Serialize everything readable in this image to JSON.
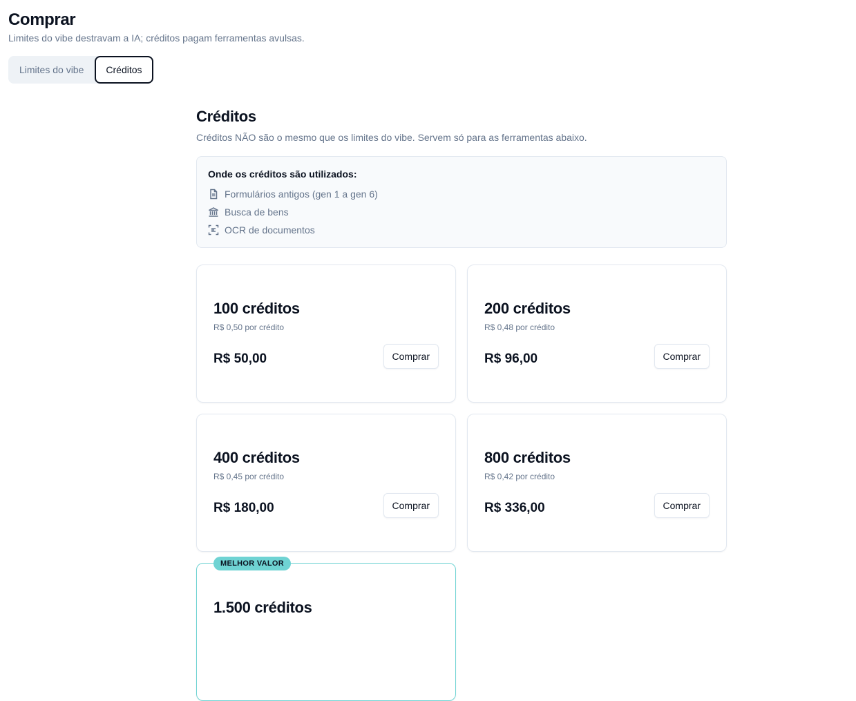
{
  "header": {
    "title": "Comprar",
    "subtitle": "Limites do vibe destravam a IA; créditos pagam ferramentas avulsas."
  },
  "tabs": [
    {
      "label": "Limites do vibe",
      "active": false
    },
    {
      "label": "Créditos",
      "active": true
    }
  ],
  "credits": {
    "title": "Créditos",
    "description": "Créditos NÃO são o mesmo que os limites do vibe. Servem só para as ferramentas abaixo.",
    "usage": {
      "title": "Onde os créditos são utilizados:",
      "items": [
        {
          "icon": "document-icon",
          "label": "Formulários antigos (gen 1 a gen 6)"
        },
        {
          "icon": "bank-icon",
          "label": "Busca de bens"
        },
        {
          "icon": "scan-text-icon",
          "label": "OCR de documentos"
        }
      ]
    },
    "buy_label": "Comprar",
    "packages": [
      {
        "title": "100 créditos",
        "unit_price": "R$ 0,50 por crédito",
        "price": "R$ 50,00"
      },
      {
        "title": "200 créditos",
        "unit_price": "R$ 0,48 por crédito",
        "price": "R$ 96,00"
      },
      {
        "title": "400 créditos",
        "unit_price": "R$ 0,45 por crédito",
        "price": "R$ 180,00"
      },
      {
        "title": "800 créditos",
        "unit_price": "R$ 0,42 por crédito",
        "price": "R$ 336,00"
      },
      {
        "title": "1.500 créditos",
        "badge": "MELHOR VALOR",
        "featured": true
      }
    ]
  },
  "colors": {
    "accent": "#6fd3d3",
    "text": "#0b1220",
    "muted": "#64748b",
    "border": "#e2e8f0"
  }
}
